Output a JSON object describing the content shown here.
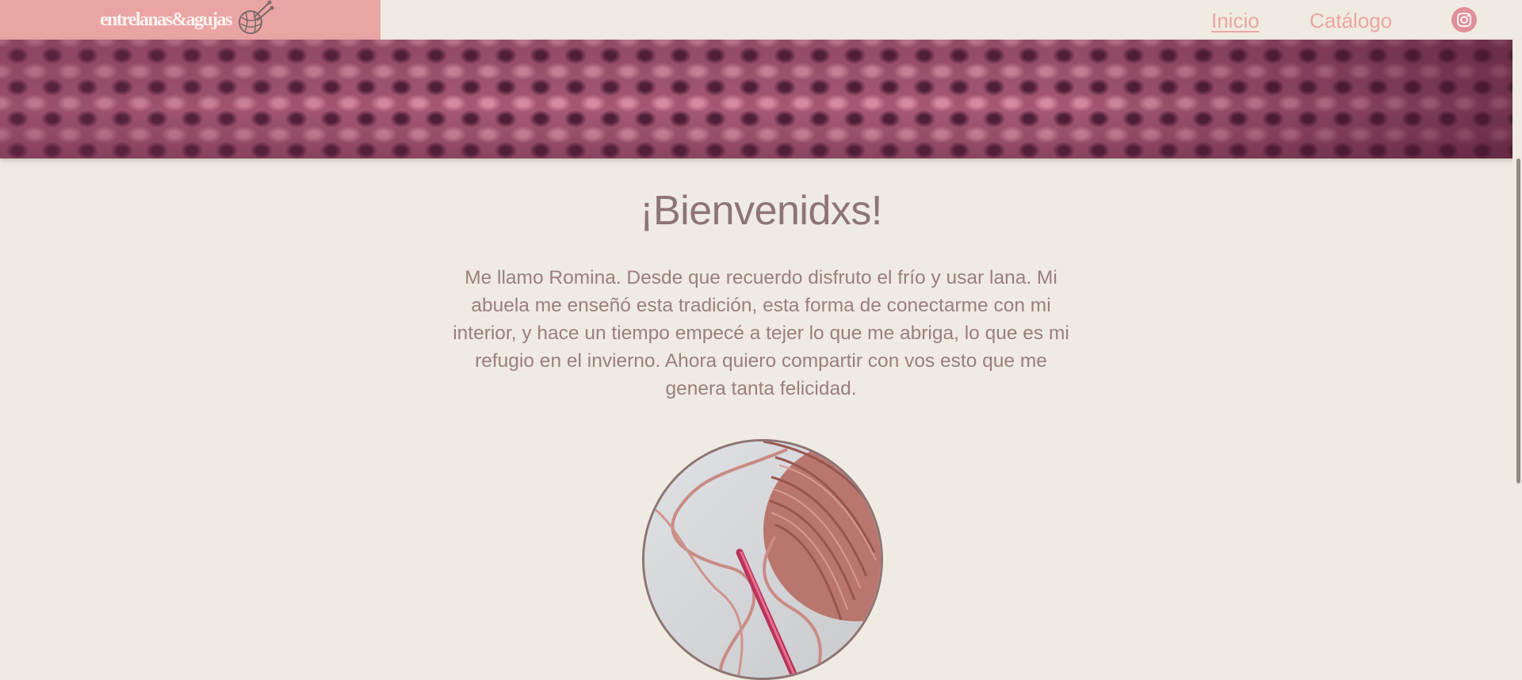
{
  "brand": {
    "name": "entrelanas&agujas",
    "logo_icon": "yarn-ball-needles-icon"
  },
  "nav": {
    "items": [
      {
        "label": "Inicio",
        "active": true
      },
      {
        "label": "Catálogo",
        "active": false
      }
    ],
    "social_icon": "instagram-icon"
  },
  "hero": {
    "title": "¡Bienvenidxs!",
    "intro": "Me llamo Romina. Desde que recuerdo disfruto el frío y usar lana. Mi abuela me enseñó esta tradición, esta forma de conectarme con mi interior, y hace un tiempo empecé a tejer lo que me abriga, lo que es mi refugio en el invierno. Ahora quiero compartir con vos esto que me genera tanta felicidad."
  },
  "colors": {
    "background": "#efebe0",
    "brand_pink": "#eba4a4",
    "text_mauve": "#8e7574"
  }
}
